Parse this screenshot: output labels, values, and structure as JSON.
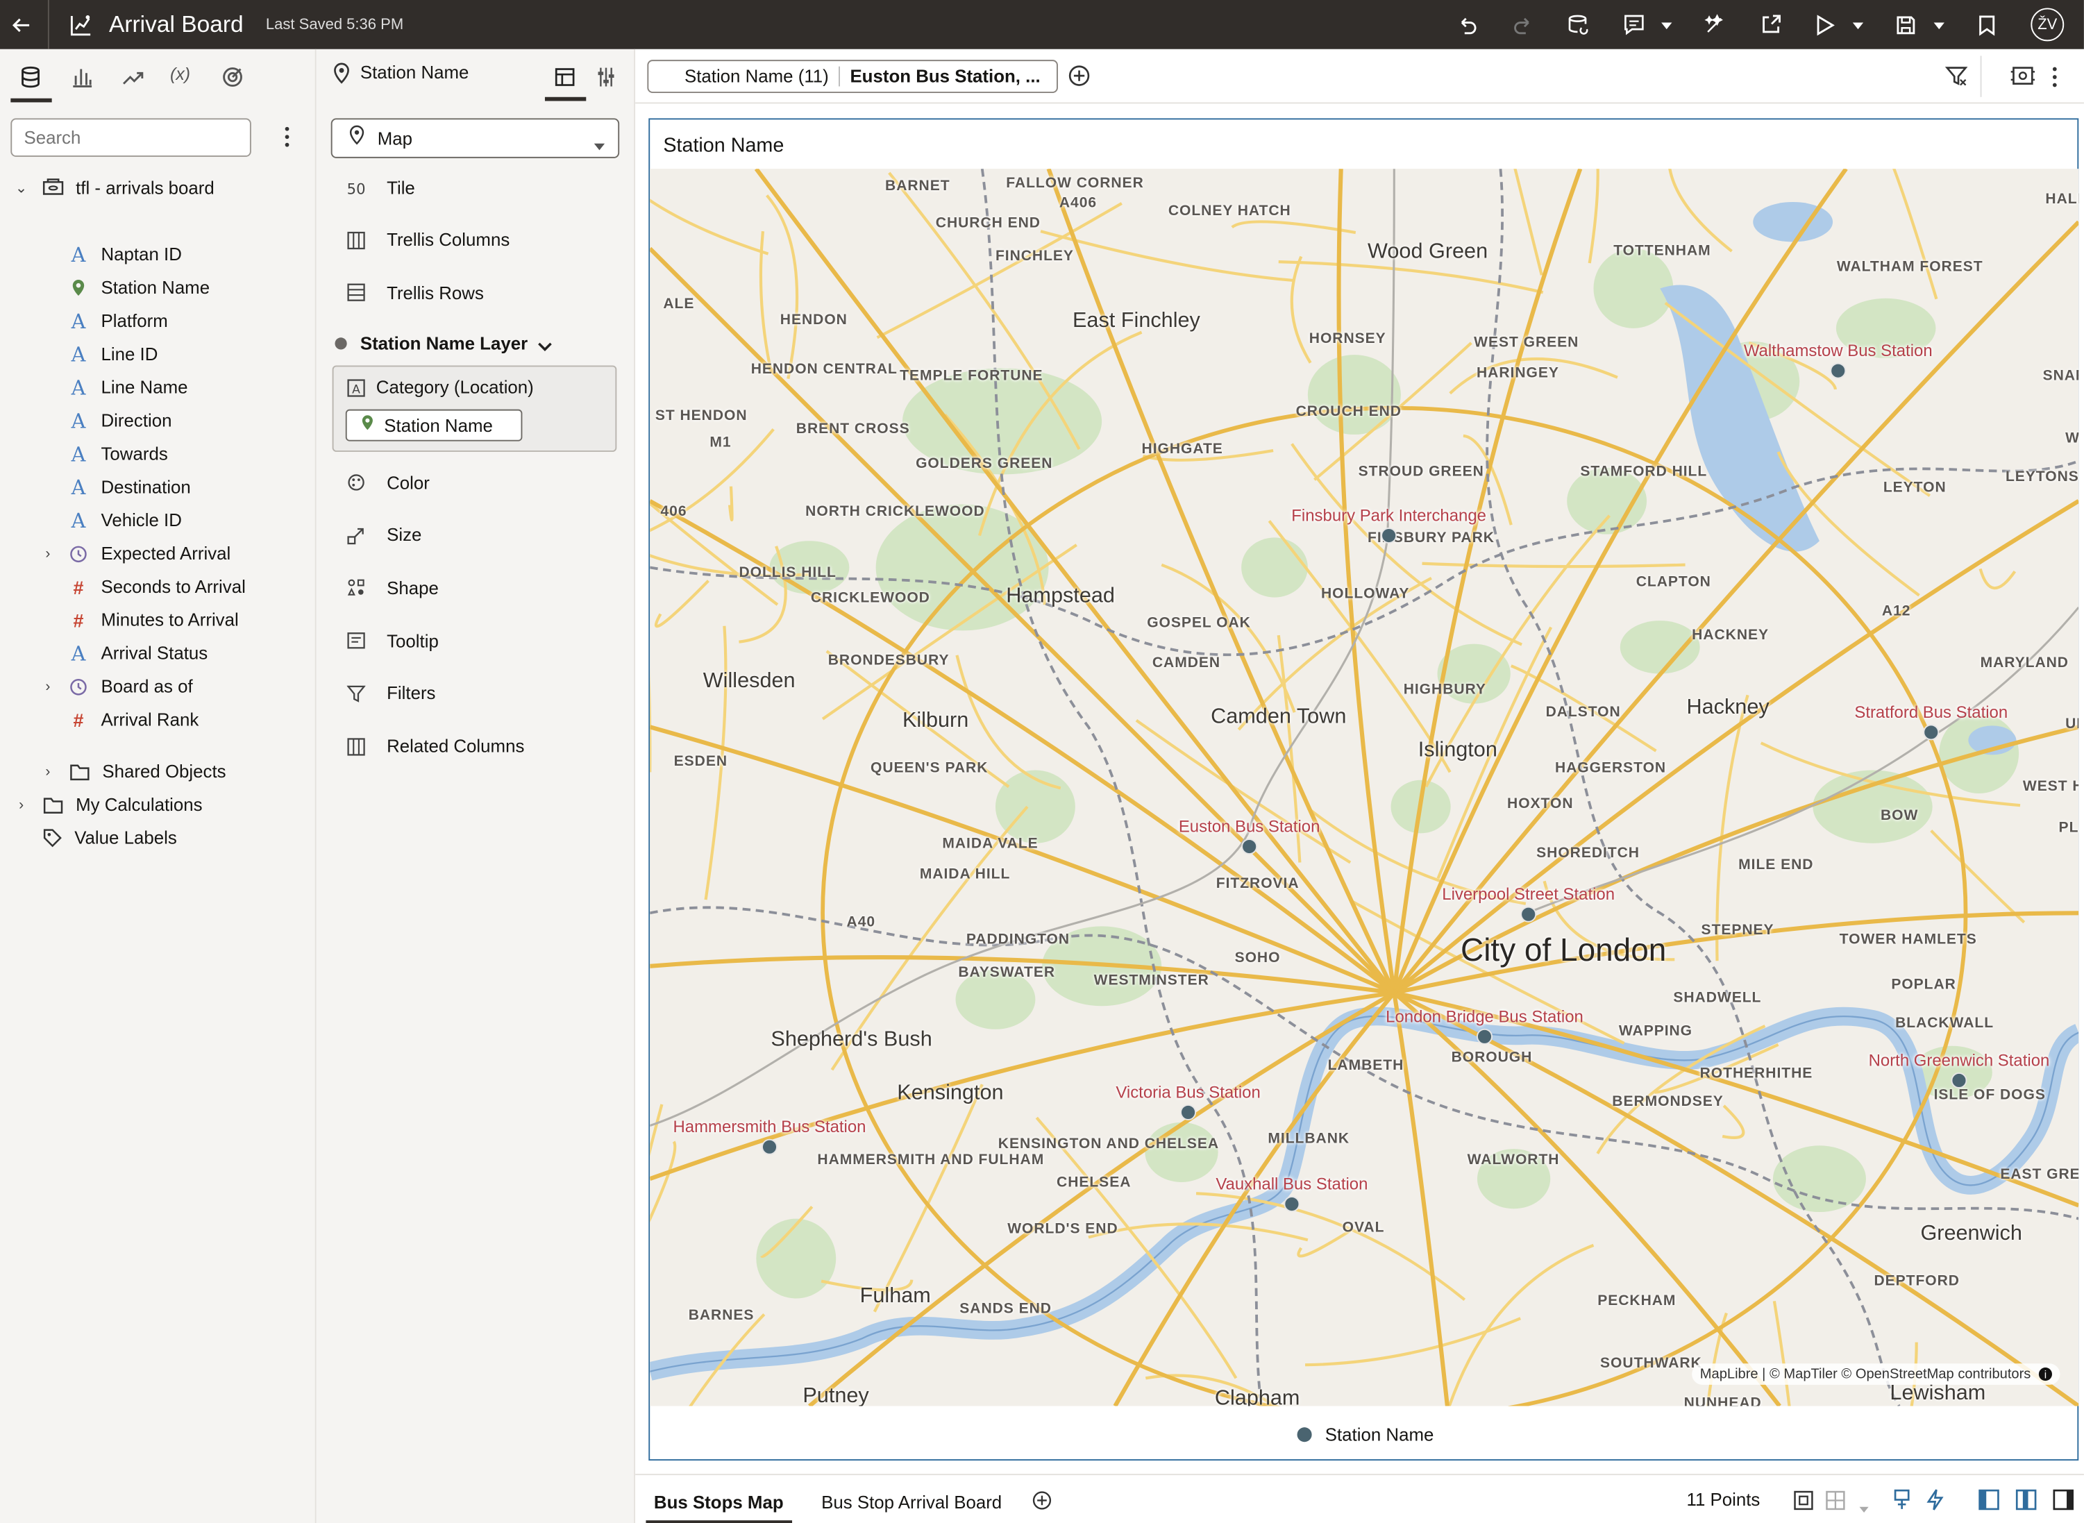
{
  "header": {
    "title": "Arrival Board",
    "saved": "Last Saved 5:36 PM",
    "avatar": "ŽV"
  },
  "data_panel": {
    "search_placeholder": "Search",
    "root": "tfl - arrivals board",
    "fields": [
      {
        "label": "Naptan ID",
        "type": "text"
      },
      {
        "label": "Station Name",
        "type": "geo"
      },
      {
        "label": "Platform",
        "type": "text"
      },
      {
        "label": "Line ID",
        "type": "text"
      },
      {
        "label": "Line Name",
        "type": "text"
      },
      {
        "label": "Direction",
        "type": "text"
      },
      {
        "label": "Towards",
        "type": "text"
      },
      {
        "label": "Destination",
        "type": "text"
      },
      {
        "label": "Vehicle ID",
        "type": "text"
      },
      {
        "label": "Expected Arrival",
        "type": "time"
      },
      {
        "label": "Seconds to Arrival",
        "type": "number"
      },
      {
        "label": "Minutes to Arrival",
        "type": "number"
      },
      {
        "label": "Arrival Status",
        "type": "text"
      },
      {
        "label": "Board as of",
        "type": "time"
      },
      {
        "label": "Arrival Rank",
        "type": "number"
      }
    ],
    "folders": [
      "Shared Objects",
      "My Calculations",
      "Value Labels"
    ]
  },
  "grammar": {
    "header": "Station Name",
    "viz_type": "Map",
    "items": [
      "Tile",
      "Trellis Columns",
      "Trellis Rows"
    ],
    "layer": "Station Name Layer",
    "category": "Category (Location)",
    "category_value": "Station Name",
    "props": [
      "Color",
      "Size",
      "Shape",
      "Tooltip",
      "Filters",
      "Related Columns"
    ]
  },
  "filter_bar": {
    "filter_label": "Station Name (11)",
    "filter_value": "Euston Bus Station, ..."
  },
  "viz": {
    "title": "Station Name",
    "attribution": "MapLibre | © MapTiler  © OpenStreetMap contributors",
    "legend": "Station Name",
    "stations": [
      {
        "name": "Walthamstow Bus Station"
      },
      {
        "name": "Finsbury Park Interchange"
      },
      {
        "name": "Stratford Bus Station"
      },
      {
        "name": "Euston Bus Station"
      },
      {
        "name": "Liverpool Street Station"
      },
      {
        "name": "London Bridge Bus Station"
      },
      {
        "name": "North Greenwich Station"
      },
      {
        "name": "Victoria Bus Station"
      },
      {
        "name": "Hammersmith Bus Station"
      },
      {
        "name": "Vauxhall Bus Station"
      }
    ],
    "places": [
      "BARNET",
      "FALLOW CORNER",
      "CHURCH END",
      "FINCHLEY",
      "COLNEY HATCH",
      "Wood Green",
      "TOTTENHAM",
      "HALE END",
      "WALTHAM FOREST",
      "HENDON",
      "East Finchley",
      "HORNSEY",
      "WEST GREEN",
      "HARINGEY",
      "HENDON CENTRAL",
      "TEMPLE FORTUNE",
      "BRENT CROSS",
      "CROUCH END",
      "GOLDERS GREEN",
      "HIGHGATE",
      "STROUD GREEN",
      "STAMFORD HILL",
      "LEYTONSTONE",
      "LEYTON",
      "NORTH CRICKLEWOOD",
      "FINSBURY PARK",
      "DOLLIS HILL",
      "CRICKLEWOOD",
      "Hampstead",
      "GOSPEL OAK",
      "HOLLOWAY",
      "CLAPTON",
      "HACKNEY",
      "BRONDESBURY",
      "CAMDEN",
      "MARYLAND",
      "Willesden",
      "HIGHBURY",
      "Kilburn",
      "Camden Town",
      "DALSTON",
      "Hackney",
      "Islington",
      "QUEEN'S PARK",
      "HAGGERSTON",
      "WEST HAM",
      "HOXTON",
      "BOW",
      "MAIDA VALE",
      "SHOREDITCH",
      "MAIDA HILL",
      "FITZROVIA",
      "MILE END",
      "PADDINGTON",
      "SOHO",
      "City of London",
      "STEPNEY",
      "TOWER HAMLETS",
      "BAYSWATER",
      "WESTMINSTER",
      "SHADWELL",
      "POPLAR",
      "BLACKWALL",
      "Shepherd's Bush",
      "WAPPING",
      "BOROUGH",
      "LAMBETH",
      "ROTHERHITHE",
      "Kensington",
      "BERMONDSEY",
      "ISLE OF DOGS",
      "MILLBANK",
      "HAMMERSMITH AND FULHAM",
      "KENSINGTON AND CHELSEA",
      "WALWORTH",
      "EAST GREENWICH",
      "CHELSEA",
      "WORLD'S END",
      "OVAL",
      "Greenwich",
      "Fulham",
      "DEPTFORD",
      "SANDS END",
      "BARNES",
      "PECKHAM",
      "SOUTHWARK",
      "Putney",
      "Clapham",
      "Lewisham",
      "NUNHEAD",
      "A406",
      "A12",
      "A40",
      "M1",
      "SNARESB",
      "WAN",
      "UP",
      "PLAIS",
      "ALE",
      "ST HENDON",
      "ESDEN",
      "406"
    ]
  },
  "footer": {
    "tabs": [
      "Bus Stops Map",
      "Bus Stop Arrival Board"
    ],
    "points": "11 Points"
  },
  "colors": {
    "accent": "#312d2a",
    "marker": "#4a6470",
    "label": "#b5404a"
  }
}
